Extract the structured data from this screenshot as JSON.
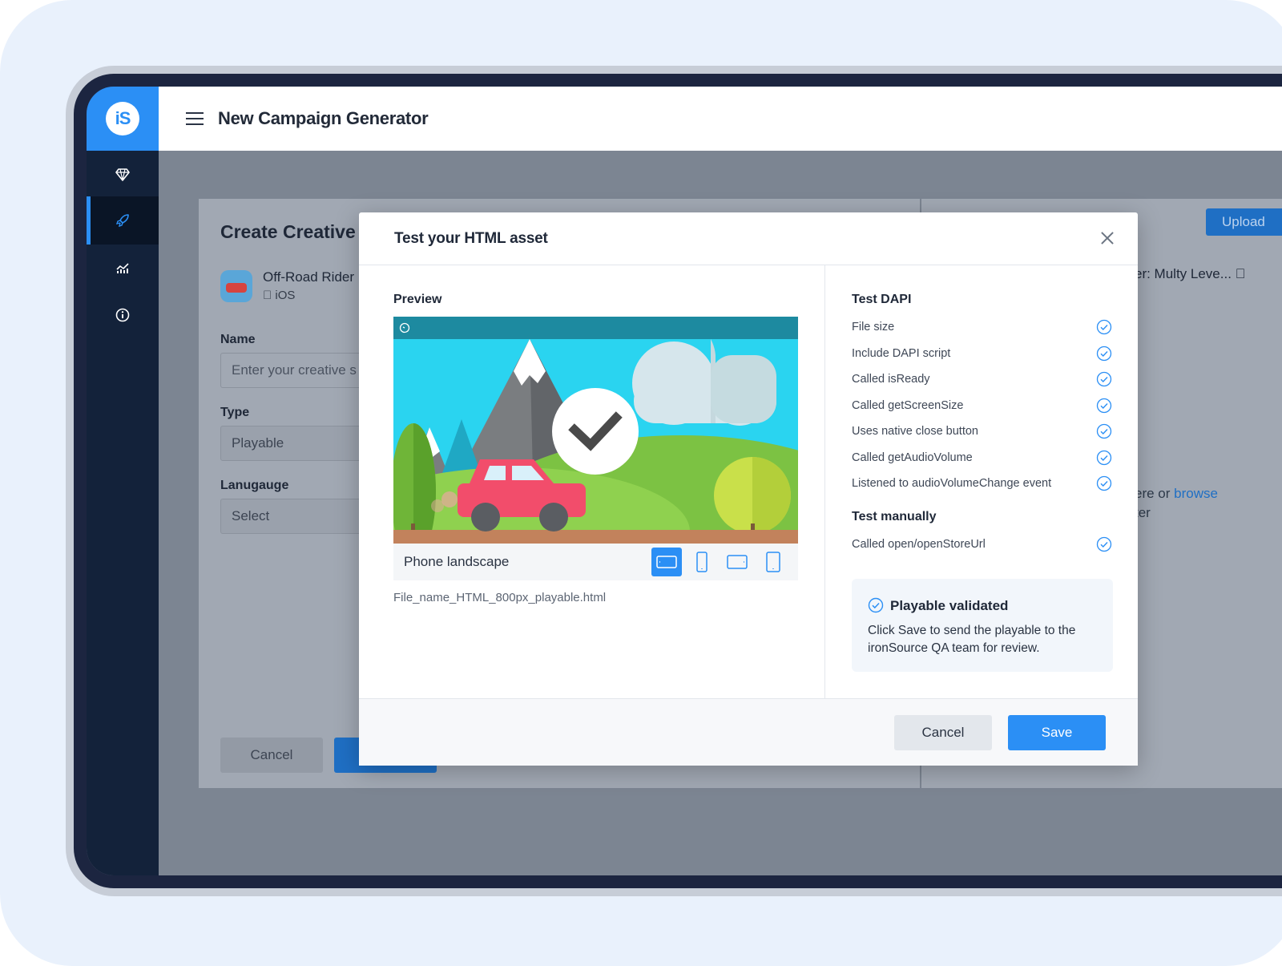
{
  "app": {
    "logo_text": "iS",
    "title": "New Campaign Generator",
    "nav_items": [
      {
        "icon": "diamond-icon"
      },
      {
        "icon": "rocket-icon",
        "active": true
      },
      {
        "icon": "analytics-icon"
      },
      {
        "icon": "info-icon"
      }
    ]
  },
  "background_page": {
    "title": "Create Creative",
    "app_name": "Off-Road Rider",
    "app_os": "iOS",
    "name_label": "Name",
    "name_placeholder": "Enter your creative s",
    "type_label": "Type",
    "type_value": "Playable",
    "language_label": "Lanugauge",
    "language_value": "Select",
    "cancel_label": "Cancel",
    "upload_label": "Upload",
    "multy_text": "er: Multy Leve...",
    "drop_text_prefix": "ere or ",
    "drop_link": "browse",
    "drop_text_2": "ter"
  },
  "modal": {
    "title": "Test your HTML asset",
    "preview_label": "Preview",
    "device_label": "Phone landscape",
    "devices": [
      "phone-landscape-icon",
      "phone-portrait-icon",
      "tablet-landscape-icon",
      "tablet-portrait-icon"
    ],
    "file_name": "File_name_HTML_800px_playable.html",
    "test_dapi_title": "Test DAPI",
    "dapi_checks": [
      "File size",
      "Include DAPI script",
      "Called isReady",
      "Called getScreenSize",
      "Uses native close button",
      "Called getAudioVolume",
      "Listened to audioVolumeChange event"
    ],
    "test_manual_title": "Test manually",
    "manual_checks": [
      "Called open/openStoreUrl"
    ],
    "validated_title": "Playable validated",
    "validated_text": "Click Save to send the playable to the ironSource QA team for review.",
    "cancel_label": "Cancel",
    "save_label": "Save"
  },
  "colors": {
    "accent": "#2b8ff5",
    "sidebar": "#13223a",
    "check": "#2b8ff5"
  }
}
